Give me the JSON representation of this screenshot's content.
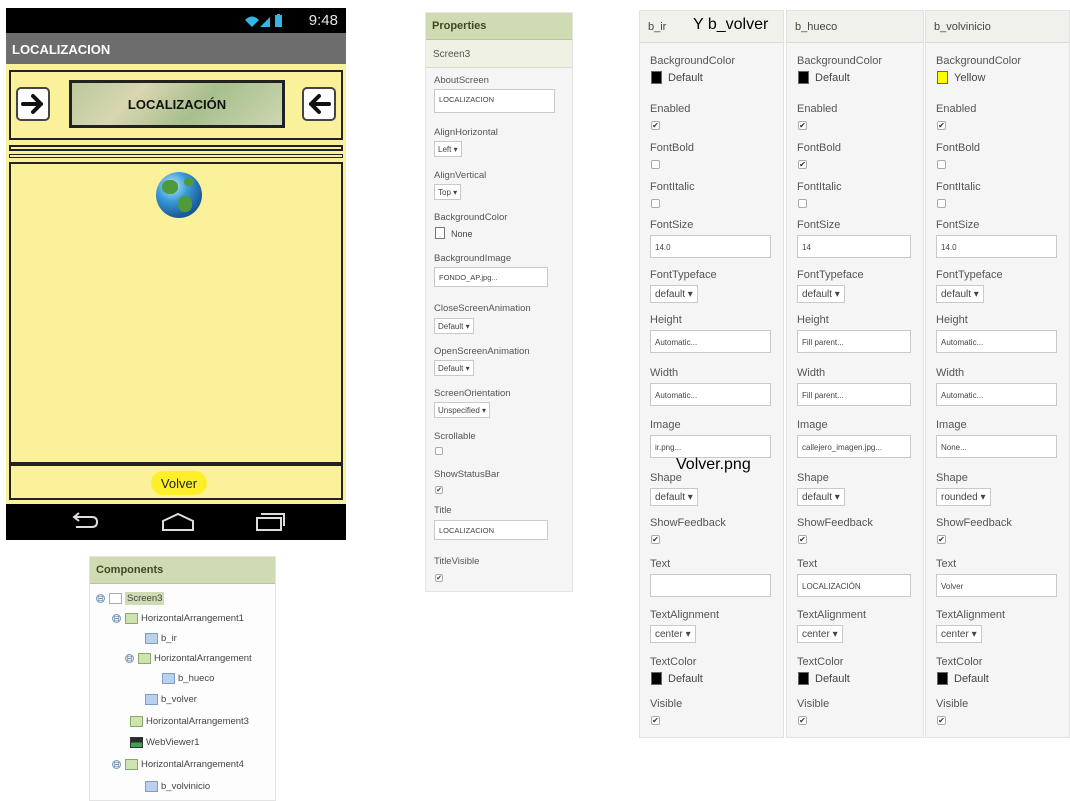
{
  "phone": {
    "status_time": "9:48",
    "app_title": "LOCALIZACION",
    "banner_label": "LOCALIZACIÓN",
    "volver_button": "Volver"
  },
  "components": {
    "header": "Components",
    "tree": [
      {
        "label": "Screen3",
        "icon": "screen-icon",
        "toggle": "⊟"
      },
      {
        "label": "HorizontalArrangement1",
        "icon": "arrangement-icon",
        "toggle": "⊟"
      },
      {
        "label": "b_ir",
        "icon": "button-icon",
        "toggle": ""
      },
      {
        "label": "HorizontalArrangement",
        "icon": "arrangement-icon",
        "toggle": "⊟"
      },
      {
        "label": "b_hueco",
        "icon": "button-icon",
        "toggle": ""
      },
      {
        "label": "b_volver",
        "icon": "button-icon",
        "toggle": ""
      },
      {
        "label": "HorizontalArrangement3",
        "icon": "arrangement-icon",
        "toggle": ""
      },
      {
        "label": "WebViewer1",
        "icon": "webviewer-icon",
        "toggle": ""
      },
      {
        "label": "HorizontalArrangement4",
        "icon": "arrangement-icon",
        "toggle": "⊟"
      },
      {
        "label": "b_volvinicio",
        "icon": "button-icon",
        "toggle": ""
      }
    ]
  },
  "screen_props": {
    "header": "Properties",
    "component": "Screen3",
    "about_label": "AboutScreen",
    "about_value": "LOCALIZACION",
    "align_h_label": "AlignHorizontal",
    "align_h_value": "Left ▾",
    "align_v_label": "AlignVertical",
    "align_v_value": "Top ▾",
    "bg_color_label": "BackgroundColor",
    "bg_color_value": "None",
    "bg_image_label": "BackgroundImage",
    "bg_image_value": "FONDO_AP.jpg...",
    "close_anim_label": "CloseScreenAnimation",
    "close_anim_value": "Default ▾",
    "open_anim_label": "OpenScreenAnimation",
    "open_anim_value": "Default ▾",
    "orientation_label": "ScreenOrientation",
    "orientation_value": "Unspecified ▾",
    "scrollable_label": "Scrollable",
    "statusbar_label": "ShowStatusBar",
    "title_label": "Title",
    "title_value": "LOCALIZACION",
    "title_visible_label": "TitleVisible",
    "check_mark": "✔"
  },
  "labels": {
    "background_color": "BackgroundColor",
    "enabled": "Enabled",
    "font_bold": "FontBold",
    "font_italic": "FontItalic",
    "font_size": "FontSize",
    "font_typeface": "FontTypeface",
    "height": "Height",
    "width": "Width",
    "image": "Image",
    "shape": "Shape",
    "show_feedback": "ShowFeedback",
    "text": "Text",
    "text_alignment": "TextAlignment",
    "text_color": "TextColor",
    "visible": "Visible",
    "check_mark": "✔"
  },
  "columns": [
    {
      "header": "b_ir",
      "bg_color": "Default",
      "bg_swatch": "#000000",
      "enabled": true,
      "font_bold": false,
      "font_italic": false,
      "font_size": "14.0",
      "font_typeface": "default ▾",
      "height": "Automatic...",
      "width": "Automatic...",
      "image": "ir.png...",
      "shape": "default ▾",
      "show_feedback": true,
      "text": "",
      "text_alignment": "center ▾",
      "text_color": "Default",
      "text_swatch": "#000000",
      "visible": true
    },
    {
      "header": "b_hueco",
      "bg_color": "Default",
      "bg_swatch": "#000000",
      "enabled": true,
      "font_bold": true,
      "font_italic": false,
      "font_size": "14",
      "font_typeface": "default ▾",
      "height": "Fill parent...",
      "width": "Fill parent...",
      "image": "callejero_imagen.jpg...",
      "shape": "default ▾",
      "show_feedback": true,
      "text": "LOCALIZACIÓN",
      "text_alignment": "center ▾",
      "text_color": "Default",
      "text_swatch": "#000000",
      "visible": true
    },
    {
      "header": "b_volvinicio",
      "bg_color": "Yellow",
      "bg_swatch": "#ffff00",
      "enabled": true,
      "font_bold": false,
      "font_italic": false,
      "font_size": "14.0",
      "font_typeface": "default ▾",
      "height": "Automatic...",
      "width": "Automatic...",
      "image": "None...",
      "shape": "rounded ▾",
      "show_feedback": true,
      "text": "Volver",
      "text_alignment": "center ▾",
      "text_color": "Default",
      "text_swatch": "#000000",
      "visible": true
    }
  ],
  "annotations": {
    "header_note": "Y b_volver",
    "image_note": "Volver.png"
  }
}
